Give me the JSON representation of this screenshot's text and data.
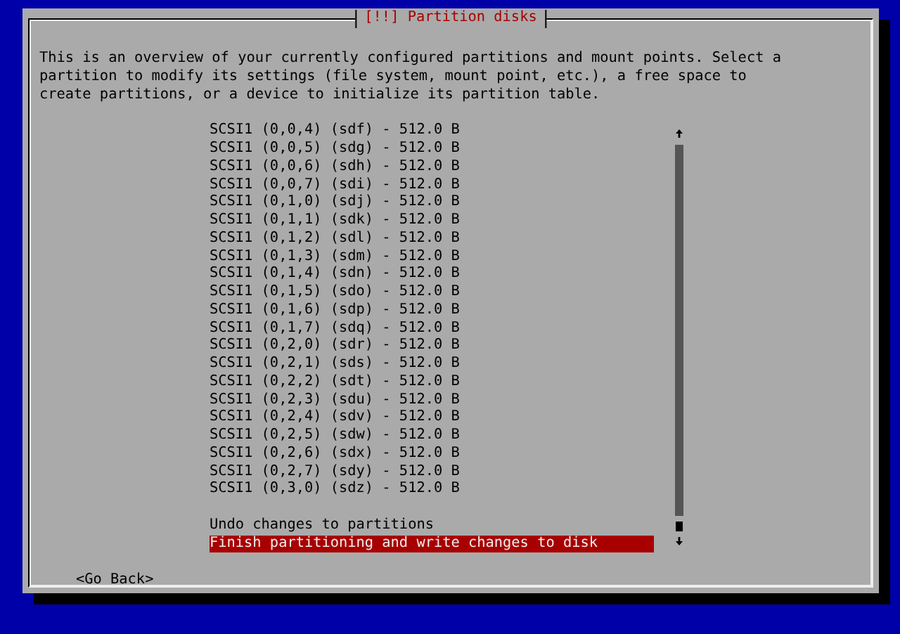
{
  "dialog": {
    "title": "[!!] Partition disks",
    "intro": "This is an overview of your currently configured partitions and mount points. Select a partition to modify its settings (file system, mount point, etc.), a free space to create partitions, or a device to initialize its partition table.",
    "devices": [
      {
        "label": "SCSI1 (0,0,4) (sdf) - 512.0 B",
        "selected": false
      },
      {
        "label": "SCSI1 (0,0,5) (sdg) - 512.0 B",
        "selected": false
      },
      {
        "label": "SCSI1 (0,0,6) (sdh) - 512.0 B",
        "selected": false
      },
      {
        "label": "SCSI1 (0,0,7) (sdi) - 512.0 B",
        "selected": false
      },
      {
        "label": "SCSI1 (0,1,0) (sdj) - 512.0 B",
        "selected": false
      },
      {
        "label": "SCSI1 (0,1,1) (sdk) - 512.0 B",
        "selected": false
      },
      {
        "label": "SCSI1 (0,1,2) (sdl) - 512.0 B",
        "selected": false
      },
      {
        "label": "SCSI1 (0,1,3) (sdm) - 512.0 B",
        "selected": false
      },
      {
        "label": "SCSI1 (0,1,4) (sdn) - 512.0 B",
        "selected": false
      },
      {
        "label": "SCSI1 (0,1,5) (sdo) - 512.0 B",
        "selected": false
      },
      {
        "label": "SCSI1 (0,1,6) (sdp) - 512.0 B",
        "selected": false
      },
      {
        "label": "SCSI1 (0,1,7) (sdq) - 512.0 B",
        "selected": false
      },
      {
        "label": "SCSI1 (0,2,0) (sdr) - 512.0 B",
        "selected": false
      },
      {
        "label": "SCSI1 (0,2,1) (sds) - 512.0 B",
        "selected": false
      },
      {
        "label": "SCSI1 (0,2,2) (sdt) - 512.0 B",
        "selected": false
      },
      {
        "label": "SCSI1 (0,2,3) (sdu) - 512.0 B",
        "selected": false
      },
      {
        "label": "SCSI1 (0,2,4) (sdv) - 512.0 B",
        "selected": false
      },
      {
        "label": "SCSI1 (0,2,5) (sdw) - 512.0 B",
        "selected": false
      },
      {
        "label": "SCSI1 (0,2,6) (sdx) - 512.0 B",
        "selected": false
      },
      {
        "label": "SCSI1 (0,2,7) (sdy) - 512.0 B",
        "selected": false
      },
      {
        "label": "SCSI1 (0,3,0) (sdz) - 512.0 B",
        "selected": false
      }
    ],
    "actions": [
      {
        "label": "Undo changes to partitions",
        "selected": false
      },
      {
        "label": "Finish partitioning and write changes to disk",
        "selected": true
      }
    ],
    "back_button": "<Go Back>"
  }
}
